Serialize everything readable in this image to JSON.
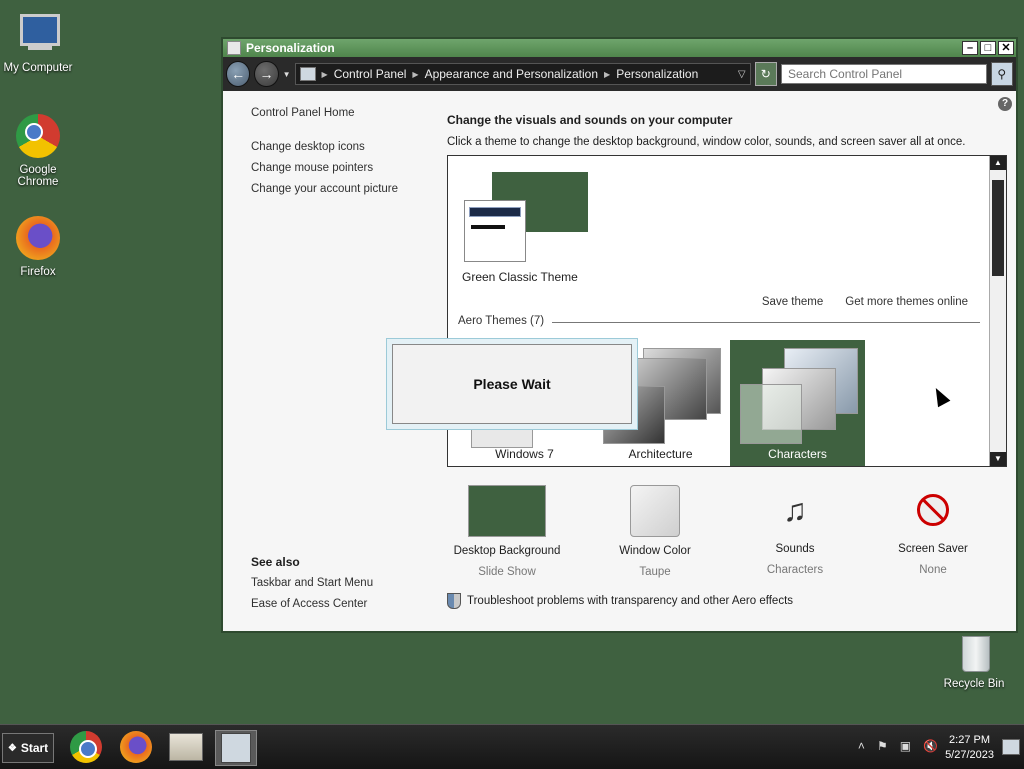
{
  "desktop": {
    "icons": [
      {
        "label": "My Computer"
      },
      {
        "label": "Google Chrome"
      },
      {
        "label": "Firefox"
      },
      {
        "label": "Recycle Bin"
      }
    ]
  },
  "window": {
    "title": "Personalization",
    "buttons": {
      "minimize": "–",
      "maximize": "□",
      "close": "✕"
    },
    "breadcrumb": [
      "Control Panel",
      "Appearance and Personalization",
      "Personalization"
    ],
    "search_placeholder": "Search Control Panel",
    "sidebar": {
      "home": "Control Panel Home",
      "links": [
        "Change desktop icons",
        "Change mouse pointers",
        "Change your account picture"
      ]
    },
    "see_also": {
      "heading": "See also",
      "links": [
        "Taskbar and Start Menu",
        "Ease of Access Center"
      ]
    },
    "main": {
      "title": "Change the visuals and sounds on your computer",
      "subtitle": "Click a theme to change the desktop background, window color, sounds, and screen saver all at once.",
      "my_theme": "Green Classic Theme",
      "save_theme": "Save theme",
      "get_more": "Get more themes online",
      "aero_header": "Aero Themes (7)",
      "themes": [
        "Windows 7",
        "Architecture",
        "Characters"
      ],
      "selected_theme": "Characters"
    },
    "customize": [
      {
        "label": "Desktop Background",
        "value": "Slide Show"
      },
      {
        "label": "Window Color",
        "value": "Taupe"
      },
      {
        "label": "Sounds",
        "value": "Characters"
      },
      {
        "label": "Screen Saver",
        "value": "None"
      }
    ],
    "troubleshoot": "Troubleshoot problems with transparency and other Aero effects"
  },
  "dialog": {
    "text": "Please Wait"
  },
  "taskbar": {
    "start": "Start",
    "time": "2:27 PM",
    "date": "5/27/2023"
  },
  "colors": {
    "desktop": "#3f6140",
    "accent": "#3f6140"
  }
}
